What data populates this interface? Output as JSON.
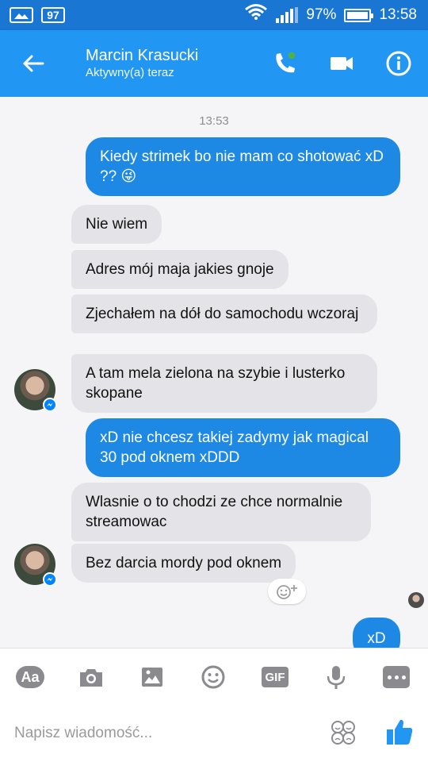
{
  "status_bar": {
    "left_indicator": "97",
    "battery_percent": "97%",
    "battery_level": 0.97,
    "time": "13:58"
  },
  "header": {
    "contact_name": "Marcin Krasucki",
    "contact_status": "Aktywny(a) teraz"
  },
  "chat": {
    "timestamp": "13:53",
    "messages": [
      {
        "direction": "out",
        "text": "Kiedy strimek bo nie mam co shotować xD ?? 😜"
      },
      {
        "direction": "in",
        "text": "Nie wiem"
      },
      {
        "direction": "in",
        "text": "Adres mój maja jakies gnoje"
      },
      {
        "direction": "in",
        "text": "Zjechałem na dół do samochodu wczoraj"
      },
      {
        "direction": "in",
        "text": "A tam mela zielona na szybie i lusterko skopane"
      },
      {
        "direction": "out",
        "text": "xD nie chcesz takiej zadymy jak magical 30 pod oknem xDDD"
      },
      {
        "direction": "in",
        "text": "Wlasnie o to chodzi ze chce normalnie streamowac"
      },
      {
        "direction": "in",
        "text": "Bez darcia mordy pod oknem"
      },
      {
        "direction": "out",
        "text": "xD"
      }
    ]
  },
  "toolbar": {
    "aa_label": "Aa",
    "gif_label": "GIF"
  },
  "composer": {
    "placeholder": "Napisz wiadomość..."
  },
  "colors": {
    "status_bar": "#1976d2",
    "header": "#2196f3",
    "outgoing_bubble": "#1e88e5",
    "incoming_bubble": "#e4e4e8",
    "chat_background": "#f5f5f7",
    "like_button": "#2196f3",
    "online_dot": "#4caf50"
  }
}
